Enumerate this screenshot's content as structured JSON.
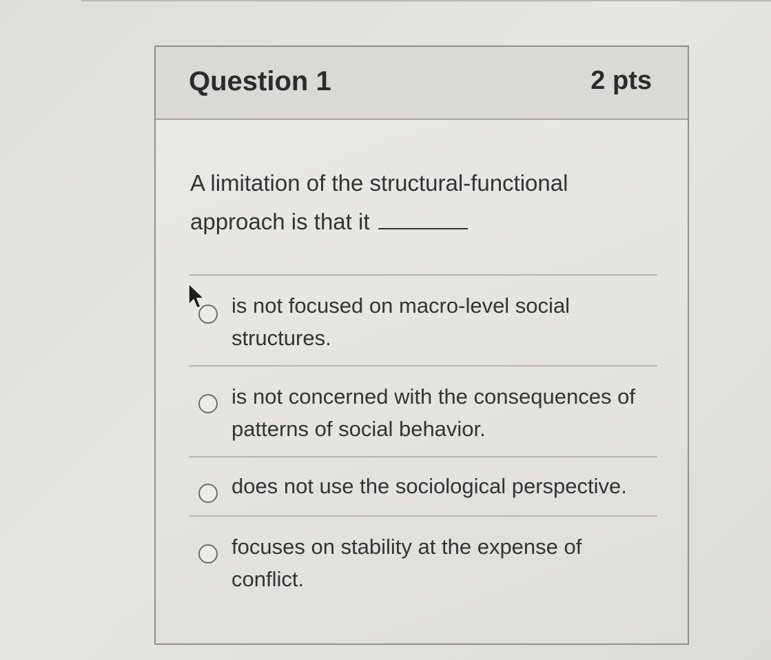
{
  "question": {
    "title": "Question 1",
    "points": "2 pts",
    "text": "A limitation of the structural-functional approach is that it"
  },
  "answers": [
    {
      "label": "is not focused on macro-level social structures.",
      "selected": false
    },
    {
      "label": "is not concerned with the consequences of patterns of social behavior.",
      "selected": false
    },
    {
      "label": "does not use the sociological perspective.",
      "selected": false
    },
    {
      "label": "focuses on stability at the expense of conflict.",
      "selected": false
    }
  ],
  "icons": {
    "cursor": "mouse-pointer-icon",
    "radio": "radio-button-icon"
  },
  "colors": {
    "header_bg": "#dad9d5",
    "border": "#8f8e8a",
    "text": "#2c2c2c"
  }
}
